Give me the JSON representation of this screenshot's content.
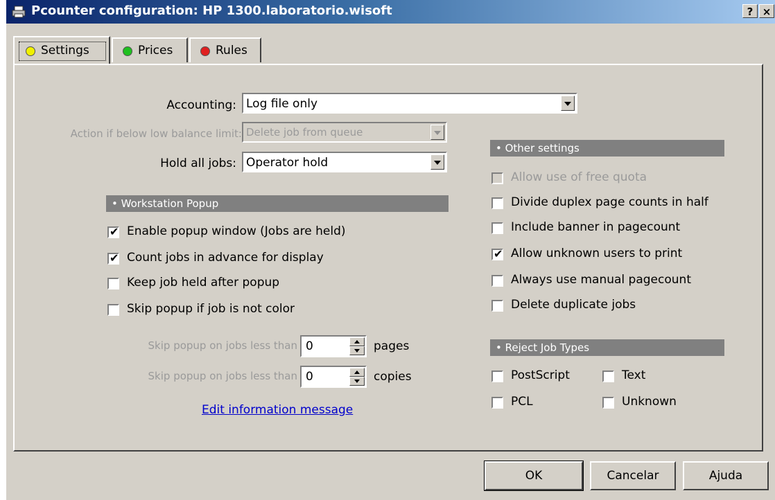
{
  "window": {
    "title": "Pcounter configuration: HP 1300.laboratorio.wisoft",
    "help_btn": "?",
    "close_btn": "×"
  },
  "tabs": [
    {
      "label": "Settings",
      "color": "#f0f000"
    },
    {
      "label": "Prices",
      "color": "#20c020"
    },
    {
      "label": "Rules",
      "color": "#e02020"
    }
  ],
  "settings": {
    "accounting_label": "Accounting:",
    "accounting_value": "Log file only",
    "action_label": "Action if below low balance limit:",
    "action_value": "Delete job from queue",
    "hold_label": "Hold all jobs:",
    "hold_value": "Operator hold"
  },
  "workstation_popup": {
    "header": "• Workstation Popup",
    "options": [
      {
        "label": "Enable popup window (Jobs are held)",
        "checked": true
      },
      {
        "label": "Count jobs in advance for display",
        "checked": true
      },
      {
        "label": "Keep job held after popup",
        "checked": false
      },
      {
        "label": "Skip popup if job is not color",
        "checked": false
      }
    ],
    "skip_pages_label": "Skip popup on jobs less than",
    "skip_pages_value": "0",
    "skip_pages_unit": "pages",
    "skip_copies_label": "Skip popup on jobs less than",
    "skip_copies_value": "0",
    "skip_copies_unit": "copies",
    "edit_link": "Edit information message"
  },
  "other_settings": {
    "header": "• Other settings",
    "options": [
      {
        "label": "Allow use of free quota",
        "checked": false,
        "disabled": true
      },
      {
        "label": "Divide duplex page counts in half",
        "checked": false
      },
      {
        "label": "Include banner in pagecount",
        "checked": false
      },
      {
        "label": "Allow unknown users to print",
        "checked": true
      },
      {
        "label": "Always use manual pagecount",
        "checked": false
      },
      {
        "label": "Delete duplicate jobs",
        "checked": false
      }
    ]
  },
  "reject_job_types": {
    "header": "• Reject Job Types",
    "options": [
      {
        "label": "PostScript",
        "checked": false
      },
      {
        "label": "Text",
        "checked": false
      },
      {
        "label": "PCL",
        "checked": false
      },
      {
        "label": "Unknown",
        "checked": false
      }
    ]
  },
  "buttons": {
    "ok": "OK",
    "cancel": "Cancelar",
    "help": "Ajuda"
  }
}
